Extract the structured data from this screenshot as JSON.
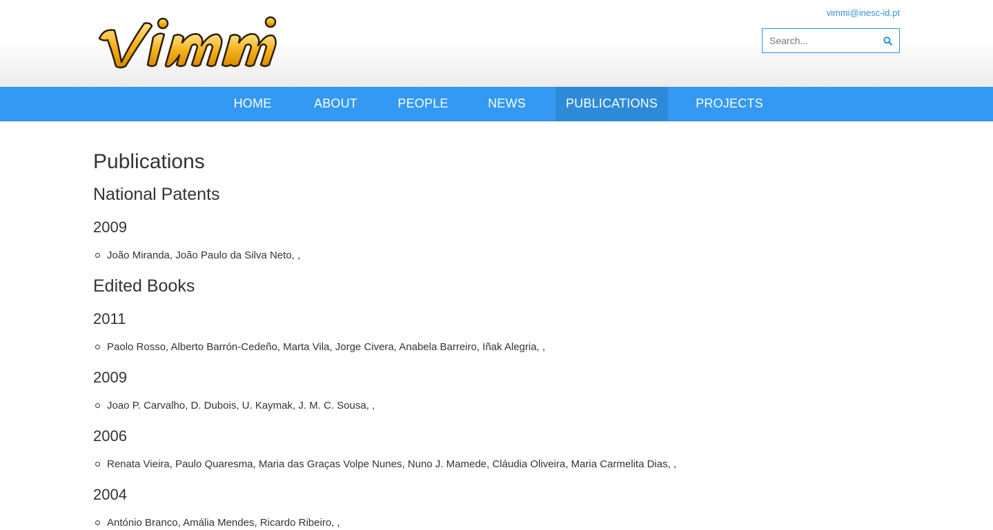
{
  "header": {
    "logo_text": "vimmi",
    "email": "vimmi@inesc-id.pt",
    "search": {
      "placeholder": "Search...",
      "value": "",
      "icon": "search-icon"
    },
    "colors": {
      "accent": "#2e8ede",
      "logo_fill": "#f5b21c",
      "logo_outline": "#2a1d05"
    }
  },
  "nav": {
    "items": [
      {
        "label": "HOME"
      },
      {
        "label": "ABOUT"
      },
      {
        "label": "PEOPLE"
      },
      {
        "label": "NEWS"
      },
      {
        "label": "PUBLICATIONS",
        "active": true
      },
      {
        "label": "PROJECTS"
      }
    ],
    "colors": {
      "bar": "#3399f3",
      "active": "#2d8ad8",
      "text": "#ffffff"
    }
  },
  "main": {
    "title": "Publications",
    "sections": [
      {
        "heading": "National Patents",
        "years": [
          {
            "year": "2009",
            "items": [
              "João Miranda, João Paulo da Silva Neto, ,"
            ]
          }
        ]
      },
      {
        "heading": "Edited Books",
        "years": [
          {
            "year": "2011",
            "items": [
              "Paolo Rosso, Alberto Barrón-Cedeño, Marta Vila, Jorge Civera, Anabela Barreiro, Iñak Alegria, ,"
            ]
          },
          {
            "year": "2009",
            "items": [
              "Joao P. Carvalho, D. Dubois, U. Kaymak, J. M. C. Sousa, ,"
            ]
          },
          {
            "year": "2006",
            "items": [
              "Renata Vieira, Paulo Quaresma, Maria das Graças Volpe Nunes, Nuno J. Mamede, Cláudia Oliveira, Maria Carmelita Dias, ,"
            ]
          },
          {
            "year": "2004",
            "items": [
              "António Branco, Amália Mendes, Ricardo Ribeiro, ,"
            ]
          }
        ]
      }
    ]
  }
}
